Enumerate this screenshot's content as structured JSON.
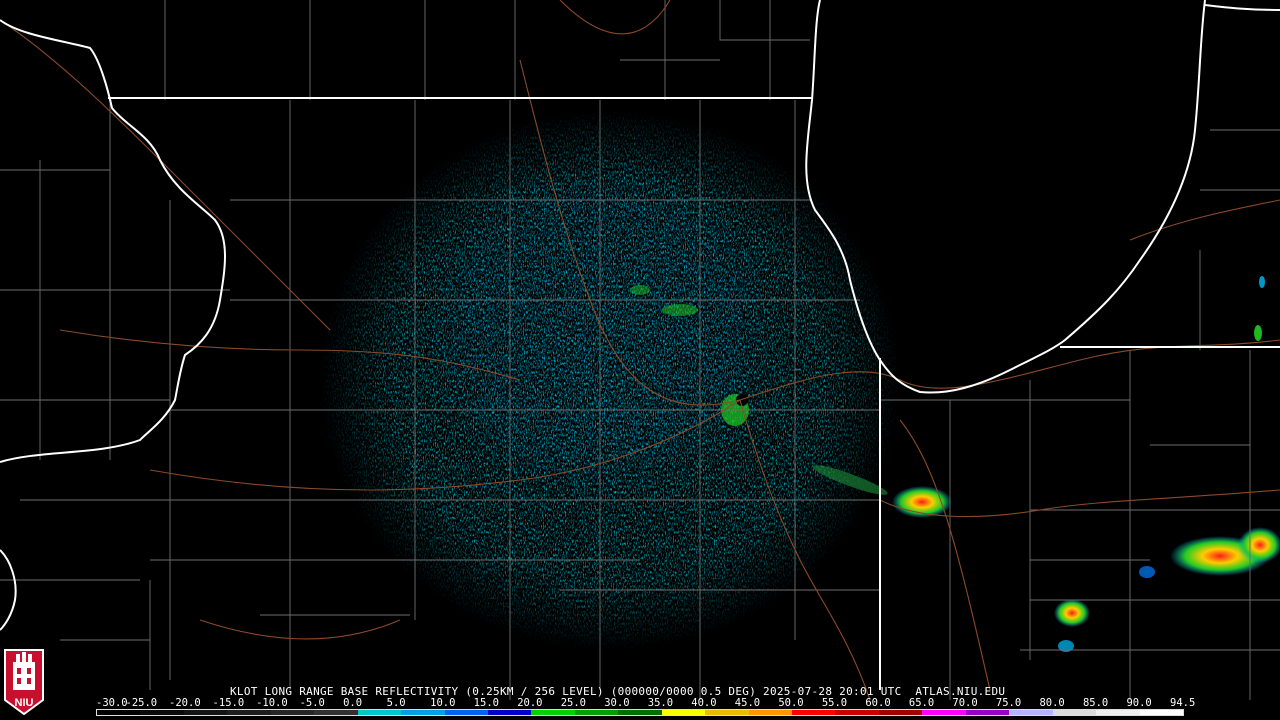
{
  "caption": {
    "text": "KLOT LONG RANGE BASE REFLECTIVITY (0.25KM / 256 LEVEL) (000000/0000 0.5 DEG) 2025-07-28 20:01 UTC  ATLAS.NIU.EDU"
  },
  "scale": {
    "labels": [
      "-30.0",
      "-25.0",
      "-20.0",
      "-15.0",
      "-10.0",
      "-5.0",
      "0.0",
      "5.0",
      "10.0",
      "15.0",
      "20.0",
      "25.0",
      "30.0",
      "35.0",
      "40.0",
      "45.0",
      "50.0",
      "55.0",
      "60.0",
      "65.0",
      "70.0",
      "75.0",
      "80.0",
      "85.0",
      "90.0",
      "94.5"
    ],
    "colors": [
      "#000000",
      "#0a0a0a",
      "#141414",
      "#1e1e1e",
      "#282828",
      "#323232",
      "#00c8c8",
      "#00a0e6",
      "#0064f0",
      "#0000c8",
      "#00d200",
      "#00a000",
      "#006e00",
      "#ffff00",
      "#e6be00",
      "#ff9600",
      "#ff0000",
      "#c80000",
      "#a00000",
      "#ff00ff",
      "#9600c8",
      "#b4b4ff",
      "#dcdcdc",
      "#f0f0f0",
      "#ffffff"
    ]
  },
  "logo": {
    "text": "NIU"
  },
  "map": {
    "site": "KLOT",
    "colors": {
      "state_border": "#ffffff",
      "county_border": "#6e6e6e",
      "highway": "#8b4a2b",
      "background": "#000000"
    }
  }
}
